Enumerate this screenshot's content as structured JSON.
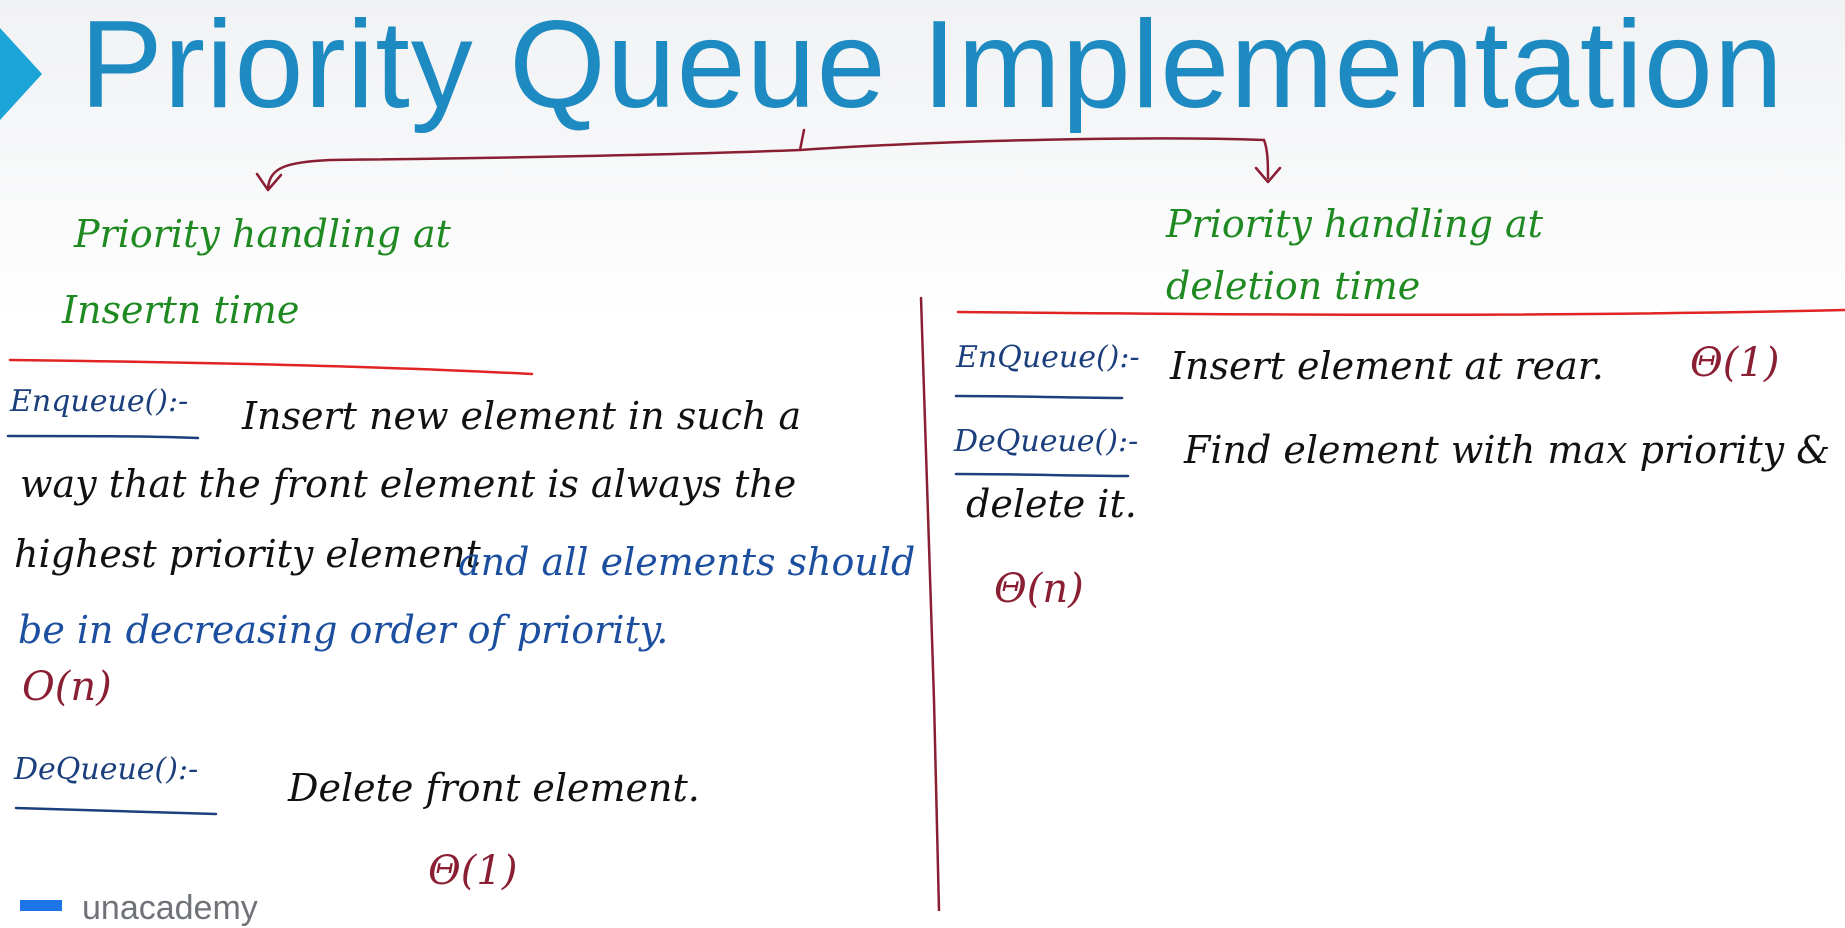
{
  "title": "Priority Queue Implementation",
  "left": {
    "heading_line1": "Priority handling at",
    "heading_line2": "Insertn time",
    "enqueue_label": "Enqueue():-",
    "enqueue_line1": "Insert new element in such a",
    "enqueue_line2": "way that the front element is always the",
    "enqueue_line3a": "highest priority element",
    "enqueue_line3b": "and all elements should",
    "enqueue_line4": "be in decreasing order of priority.",
    "enqueue_complexity": "O(n)",
    "dequeue_label": "DeQueue():-",
    "dequeue_text": "Delete front element.",
    "dequeue_complexity": "Θ(1)"
  },
  "right": {
    "heading_line1": "Priority handling at",
    "heading_line2": "deletion time",
    "enqueue_label": "EnQueue():-",
    "enqueue_text": "Insert element at rear.",
    "enqueue_complexity": "Θ(1)",
    "dequeue_label": "DeQueue():-",
    "dequeue_line1": "Find element with max priority &",
    "dequeue_line2": "delete it.",
    "dequeue_complexity": "Θ(n)"
  },
  "footer": {
    "logo_text": "unacademy"
  },
  "colors": {
    "title": "#1e8ac2",
    "title_arrow": "#1aa4d8",
    "heading_green": "#1f8a22",
    "label_navy": "#1b3f7c",
    "text_black": "#111111",
    "text_blue": "#1c4fa0",
    "complexity_maroon": "#8a1f33",
    "divider_red": "#e02424",
    "branch_maroon": "#8a1f33"
  }
}
